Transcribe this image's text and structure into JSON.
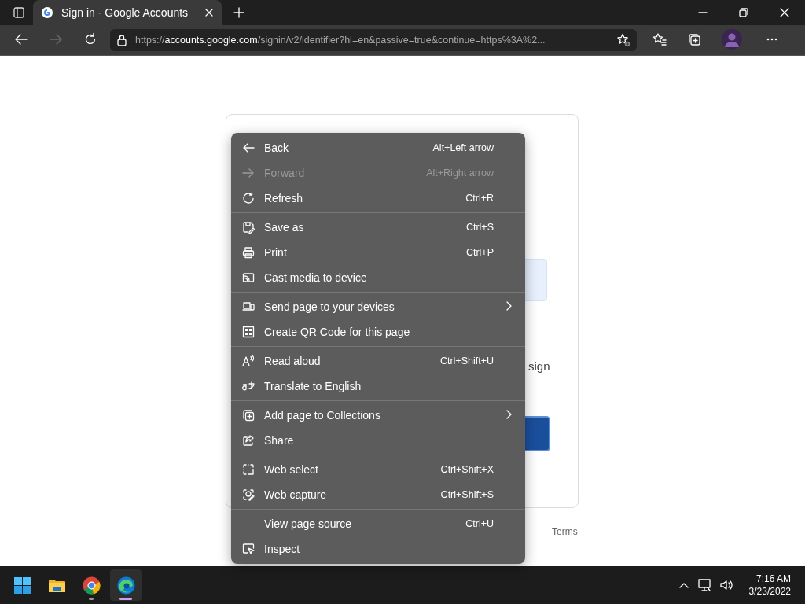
{
  "browser": {
    "tab": {
      "title": "Sign in - Google Accounts",
      "selected": true
    },
    "url_scheme": "https://",
    "url_host": "accounts.google.com",
    "url_rest": "/signin/v2/identifier?hl=en&passive=true&continue=https%3A%2...",
    "forward_disabled": true
  },
  "page": {
    "sentence_tail": "sign",
    "footer_link": "Terms"
  },
  "context_menu": {
    "groups": [
      [
        {
          "label": "Back",
          "shortcut": "Alt+Left arrow",
          "disabled": false,
          "submenu": false
        },
        {
          "label": "Forward",
          "shortcut": "Alt+Right arrow",
          "disabled": true,
          "submenu": false
        },
        {
          "label": "Refresh",
          "shortcut": "Ctrl+R",
          "disabled": false,
          "submenu": false
        }
      ],
      [
        {
          "label": "Save as",
          "shortcut": "Ctrl+S",
          "disabled": false,
          "submenu": false
        },
        {
          "label": "Print",
          "shortcut": "Ctrl+P",
          "disabled": false,
          "submenu": false
        },
        {
          "label": "Cast media to device",
          "disabled": false,
          "submenu": false
        }
      ],
      [
        {
          "label": "Send page to your devices",
          "disabled": false,
          "submenu": true
        },
        {
          "label": "Create QR Code for this page",
          "disabled": false,
          "submenu": false
        }
      ],
      [
        {
          "label": "Read aloud",
          "shortcut": "Ctrl+Shift+U",
          "disabled": false,
          "submenu": false
        },
        {
          "label": "Translate to English",
          "disabled": false,
          "submenu": false
        }
      ],
      [
        {
          "label": "Add page to Collections",
          "disabled": false,
          "submenu": true
        },
        {
          "label": "Share",
          "disabled": false,
          "submenu": false
        }
      ],
      [
        {
          "label": "Web select",
          "shortcut": "Ctrl+Shift+X",
          "disabled": false,
          "submenu": false
        },
        {
          "label": "Web capture",
          "shortcut": "Ctrl+Shift+S",
          "disabled": false,
          "submenu": false
        }
      ],
      [
        {
          "label": "View page source",
          "shortcut": "Ctrl+U",
          "disabled": false,
          "submenu": false
        },
        {
          "label": "Inspect",
          "disabled": false,
          "submenu": false
        }
      ]
    ]
  },
  "taskbar": {
    "apps": [
      {
        "kind": "start",
        "running": false,
        "active": false
      },
      {
        "kind": "files",
        "running": false,
        "active": false
      },
      {
        "kind": "chrome",
        "running": true,
        "active": false
      },
      {
        "kind": "edge",
        "running": true,
        "active": true
      }
    ],
    "time": "7:16 AM",
    "date": "3/23/2022"
  }
}
